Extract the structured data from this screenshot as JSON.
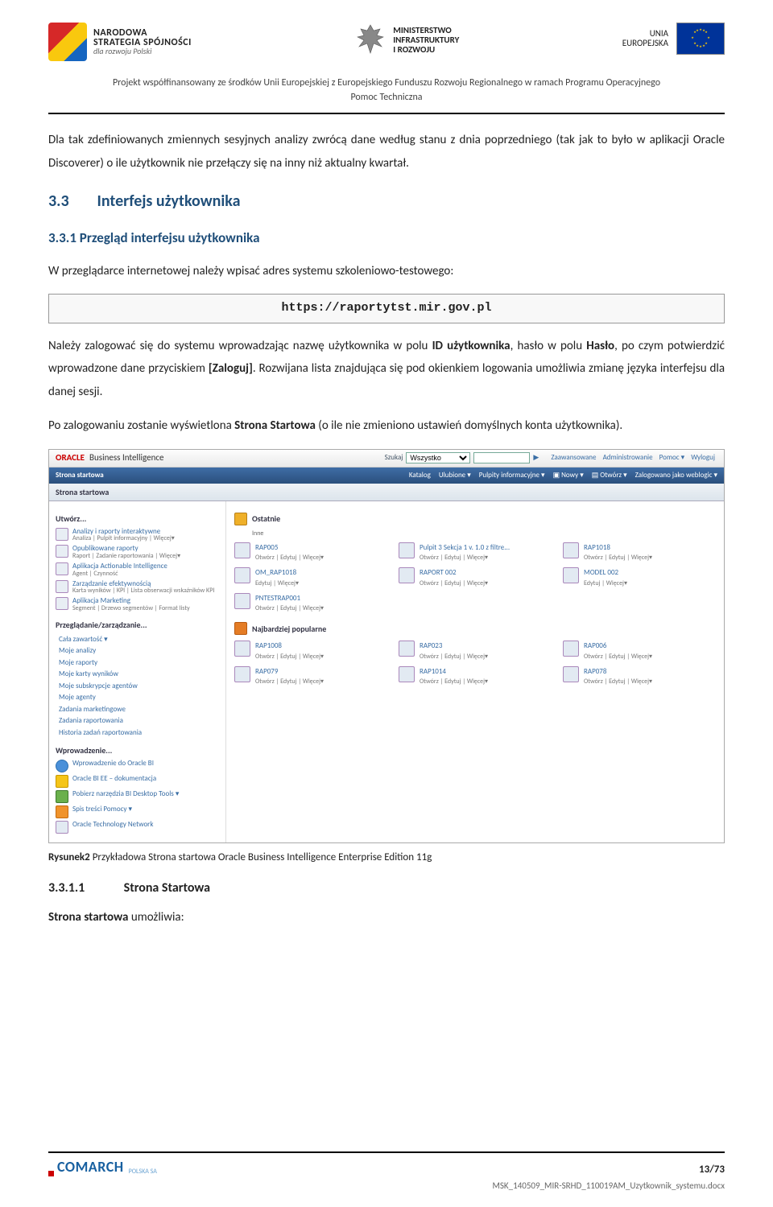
{
  "header": {
    "nss": {
      "l1": "NARODOWA",
      "l2": "STRATEGIA SPÓJNOŚCI",
      "l3": "dla rozwoju Polski"
    },
    "ministry": {
      "l1": "MINISTERSTWO",
      "l2": "INFRASTRUKTURY",
      "l3": "I ROZWOJU"
    },
    "eu": {
      "l1": "UNIA",
      "l2": "EUROPEJSKA"
    },
    "subheader_l1": "Projekt współfinansowany ze środków Unii Europejskiej z Europejskiego Funduszu Rozwoju Regionalnego w ramach Programu Operacyjnego",
    "subheader_l2": "Pomoc Techniczna"
  },
  "para1": "Dla tak zdefiniowanych zmiennych sesyjnych analizy zwrócą dane według stanu z dnia poprzedniego (tak jak to było w aplikacji Oracle Discoverer) o ile użytkownik nie przełączy się na inny niż aktualny kwartał.",
  "h_33_num": "3.3",
  "h_33_title": "Interfejs użytkownika",
  "h_331": "3.3.1 Przegląd interfejsu użytkownika",
  "para2": "W przeglądarce internetowej należy wpisać adres systemu szkoleniowo-testowego:",
  "url": "https://raportytst.mir.gov.pl",
  "para3": "Należy zalogować się do systemu wprowadzając nazwę użytkownika w polu ID użytkownika, hasło w polu Hasło, po czym potwierdzić wprowadzone dane przyciskiem [Zaloguj]. Rozwijana lista znajdująca się pod okienkiem logowania umożliwia zmianę języka interfejsu dla danej sesji.",
  "para4": "Po zalogowaniu zostanie wyświetlona Strona Startowa (o ile nie zmieniono ustawień domyślnych konta użytkownika).",
  "screenshot": {
    "oracle": "ORACLE",
    "bi": "Business Intelligence",
    "search_label": "Szukaj",
    "search_select": "Wszystko",
    "toplinks": [
      "Zaawansowane",
      "Administrowanie",
      "Pomoc ▾",
      "Wyloguj"
    ],
    "nav": {
      "home": "Strona startowa",
      "items": [
        "Katalog",
        "Ulubione ▾",
        "Pulpity informacyjne ▾",
        "▣ Nowy ▾",
        "▤ Otwórz ▾",
        "Zalogowano jako weblogic ▾"
      ]
    },
    "tab": "Strona startowa",
    "left": {
      "utworz": "Utwórz...",
      "items": [
        {
          "t1": "Analizy i raporty interaktywne",
          "t2": "Analiza | Pulpit informacyjny | Więcej▾"
        },
        {
          "t1": "Opublikowane raporty",
          "t2": "Raport | Zadanie raportowania | Więcej▾"
        },
        {
          "t1": "Aplikacja Actionable Intelligence",
          "t2": "Agent | Czynność"
        },
        {
          "t1": "Zarządzanie efektywnością",
          "t2": "Karta wyników | KPI | Lista obserwacji wskaźników KPI"
        },
        {
          "t1": "Aplikacja Marketing",
          "t2": "Segment | Drzewo segmentów | Format listy"
        }
      ],
      "przegladanie": "Przeglądanie/zarządzanie...",
      "links1": [
        "Cała zawartość ▾",
        "Moje analizy",
        "Moje raporty",
        "Moje karty wyników",
        "Moje subskrypcje agentów",
        "Moje agenty",
        "Zadania marketingowe",
        "Zadania raportowania",
        "Historia zadań raportowania"
      ],
      "wprowadzenie": "Wprowadzenie...",
      "links2": [
        {
          "cls": "round",
          "t": "Wprowadzenie do Oracle BI"
        },
        {
          "cls": "yellow",
          "t": "Oracle BI EE – dokumentacja"
        },
        {
          "cls": "green",
          "t": "Pobierz narzędzia BI Desktop Tools ▾"
        },
        {
          "cls": "orange",
          "t": "Spis treści Pomocy ▾"
        },
        {
          "cls": "doc",
          "t": "Oracle Technology Network"
        }
      ]
    },
    "right": {
      "ostatnie": "Ostatnie",
      "inne": "Inne",
      "rows1": [
        [
          {
            "t1": "RAP005",
            "t2": "Otwórz | Edytuj | Więcej▾"
          },
          {
            "t1": "Pulpit 3 Sekcja 1 v. 1.0 z filtre...",
            "t2": "Otwórz | Edytuj | Więcej▾"
          },
          {
            "t1": "RAP1018",
            "t2": "Otwórz | Edytuj | Więcej▾"
          }
        ],
        [
          {
            "t1": "OM_RAP1018",
            "t2": "Edytuj | Więcej▾"
          },
          {
            "t1": "RAPORT 002",
            "t2": "Otwórz | Edytuj | Więcej▾"
          },
          {
            "t1": "MODEL 002",
            "t2": "Edytuj | Więcej▾"
          }
        ],
        [
          {
            "t1": "PNTESTRAP001",
            "t2": "Otwórz | Edytuj | Więcej▾"
          },
          {
            "t1": "",
            "t2": ""
          },
          {
            "t1": "",
            "t2": ""
          }
        ]
      ],
      "najbardziej": "Najbardziej popularne",
      "rows2": [
        [
          {
            "t1": "RAP1008",
            "t2": "Otwórz | Edytuj | Więcej▾"
          },
          {
            "t1": "RAP023",
            "t2": "Otwórz | Edytuj | Więcej▾"
          },
          {
            "t1": "RAP006",
            "t2": "Otwórz | Edytuj | Więcej▾"
          }
        ],
        [
          {
            "t1": "RAP079",
            "t2": "Otwórz | Edytuj | Więcej▾"
          },
          {
            "t1": "RAP1014",
            "t2": "Otwórz | Edytuj | Więcej▾"
          },
          {
            "t1": "RAP078",
            "t2": "Otwórz | Edytuj | Więcej▾"
          }
        ]
      ]
    }
  },
  "caption": "Rysunek2 Przykładowa Strona startowa Oracle Business Intelligence Enterprise Edition 11g",
  "h_3311_num": "3.3.1.1",
  "h_3311_title": "Strona Startowa",
  "para5": "Strona startowa umożliwia:",
  "footer": {
    "comarch": "COMARCH",
    "comarch_sub": "POLSKA SA",
    "page": "13/73",
    "file": "MSK_140509_MIR-SRHD_110019AM_Uzytkownik_systemu.docx"
  }
}
